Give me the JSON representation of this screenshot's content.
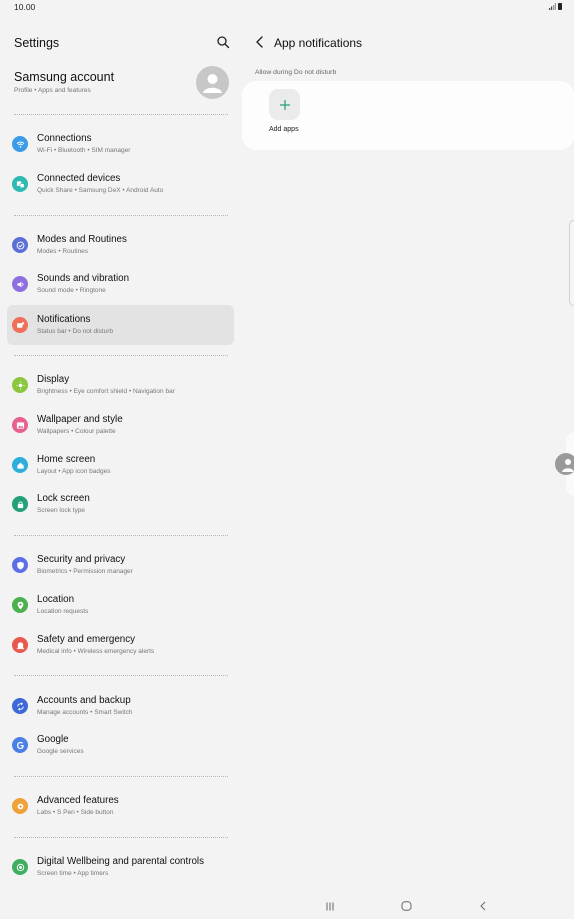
{
  "status_bar": {
    "time": "10.00"
  },
  "left_pane": {
    "title": "Settings",
    "account": {
      "name": "Samsung account",
      "subtitle": "Profile  •  Apps and features"
    },
    "items": [
      {
        "title": "Connections",
        "subtitle": "Wi-Fi  •  Bluetooth  •  SIM manager",
        "color": "#3a9be8",
        "icon": "wifi-icon"
      },
      {
        "title": "Connected devices",
        "subtitle": "Quick Share  •  Samsung DeX  •  Android Auto",
        "color": "#2fb9b0",
        "icon": "connected-devices-icon"
      },
      {
        "title": "Modes and Routines",
        "subtitle": "Modes  •  Routines",
        "color": "#5b6fd6",
        "icon": "check-circle-icon"
      },
      {
        "title": "Sounds and vibration",
        "subtitle": "Sound mode  •  Ringtone",
        "color": "#8e6fe0",
        "icon": "speaker-icon"
      },
      {
        "title": "Notifications",
        "subtitle": "Status bar  •  Do not disturb",
        "color": "#ef6f5a",
        "icon": "notification-icon"
      },
      {
        "title": "Display",
        "subtitle": "Brightness  •  Eye comfort shield  •  Navigation bar",
        "color": "#8cc63f",
        "icon": "sun-icon"
      },
      {
        "title": "Wallpaper and style",
        "subtitle": "Wallpapers  •  Colour palette",
        "color": "#e8608f",
        "icon": "image-icon"
      },
      {
        "title": "Home screen",
        "subtitle": "Layout  •  App icon badges",
        "color": "#2eaedb",
        "icon": "home-icon"
      },
      {
        "title": "Lock screen",
        "subtitle": "Screen lock type",
        "color": "#23a07a",
        "icon": "lock-icon"
      },
      {
        "title": "Security and privacy",
        "subtitle": "Biometrics  •  Permission manager",
        "color": "#5d6fe6",
        "icon": "shield-icon"
      },
      {
        "title": "Location",
        "subtitle": "Location requests",
        "color": "#4caf50",
        "icon": "location-icon"
      },
      {
        "title": "Safety and emergency",
        "subtitle": "Medical info  •  Wireless emergency alerts",
        "color": "#e85a4f",
        "icon": "emergency-icon"
      },
      {
        "title": "Accounts and backup",
        "subtitle": "Manage accounts  •  Smart Switch",
        "color": "#3d68d8",
        "icon": "sync-icon"
      },
      {
        "title": "Google",
        "subtitle": "Google services",
        "color": "#4a7fe8",
        "icon": "google-icon"
      },
      {
        "title": "Advanced features",
        "subtitle": "Labs  •  S Pen  •  Side button",
        "color": "#f0a23a",
        "icon": "gear-plus-icon"
      },
      {
        "title": "Digital Wellbeing and parental controls",
        "subtitle": "Screen time  •  App timers",
        "color": "#3fae5f",
        "icon": "wellbeing-icon"
      }
    ]
  },
  "right_pane": {
    "title": "App notifications",
    "section_label": "Allow during Do not disturb",
    "add_label": "Add apps",
    "accent": "#1f9e6e"
  }
}
